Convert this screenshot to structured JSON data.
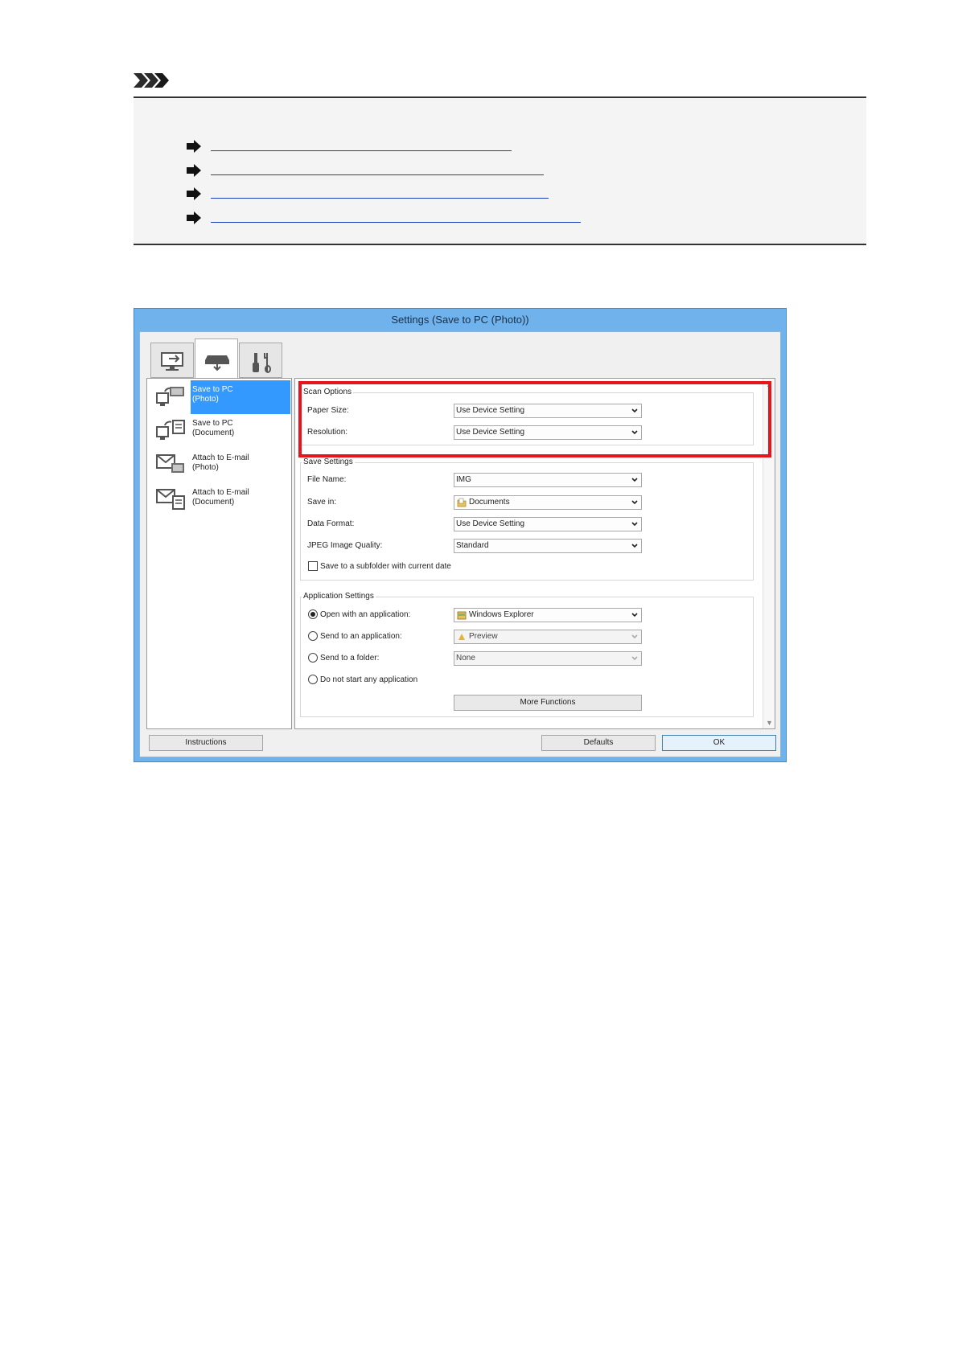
{
  "note": {
    "icon": "note-arrows-icon",
    "links": [
      {
        "icon": "right-arrow-icon",
        "text": ""
      },
      {
        "icon": "right-arrow-icon",
        "text": ""
      },
      {
        "icon": "right-arrow-icon",
        "text": ""
      },
      {
        "icon": "right-arrow-icon",
        "text": ""
      }
    ]
  },
  "dialog": {
    "title": "Settings (Save to PC (Photo))",
    "tabs": [
      {
        "icon": "computer-scan-icon",
        "active": false
      },
      {
        "icon": "scanner-icon",
        "active": true
      },
      {
        "icon": "tools-icon",
        "active": false
      }
    ],
    "sidebar": [
      {
        "label": "Save to PC\n(Photo)",
        "icon": "save-photo-icon",
        "active": true
      },
      {
        "label": "Save to PC\n(Document)",
        "icon": "save-document-icon",
        "active": false
      },
      {
        "label": "Attach to E-mail\n(Photo)",
        "icon": "email-photo-icon",
        "active": false
      },
      {
        "label": "Attach to E-mail\n(Document)",
        "icon": "email-document-icon",
        "active": false
      }
    ],
    "scan_options": {
      "title": "Scan Options",
      "paper_size_label": "Paper Size:",
      "paper_size_value": "Use Device Setting",
      "resolution_label": "Resolution:",
      "resolution_value": "Use Device Setting"
    },
    "save_settings": {
      "title": "Save Settings",
      "file_name_label": "File Name:",
      "file_name_value": "IMG",
      "save_in_label": "Save in:",
      "save_in_value": "Documents",
      "data_format_label": "Data Format:",
      "data_format_value": "Use Device Setting",
      "jpeg_quality_label": "JPEG Image Quality:",
      "jpeg_quality_value": "Standard",
      "subfolder_label": "Save to a subfolder with current date"
    },
    "application_settings": {
      "title": "Application Settings",
      "open_with_label": "Open with an application:",
      "open_with_value": "Windows Explorer",
      "send_to_app_label": "Send to an application:",
      "send_to_app_value": "Preview",
      "send_to_folder_label": "Send to a folder:",
      "send_to_folder_value": "None",
      "do_not_start_label": "Do not start any application",
      "more_functions_label": "More Functions"
    },
    "buttons": {
      "instructions": "Instructions",
      "defaults": "Defaults",
      "ok": "OK"
    },
    "colors": {
      "titlebar": "#6fb2ec",
      "selection": "#3399ff",
      "highlight": "#e8141b"
    }
  }
}
